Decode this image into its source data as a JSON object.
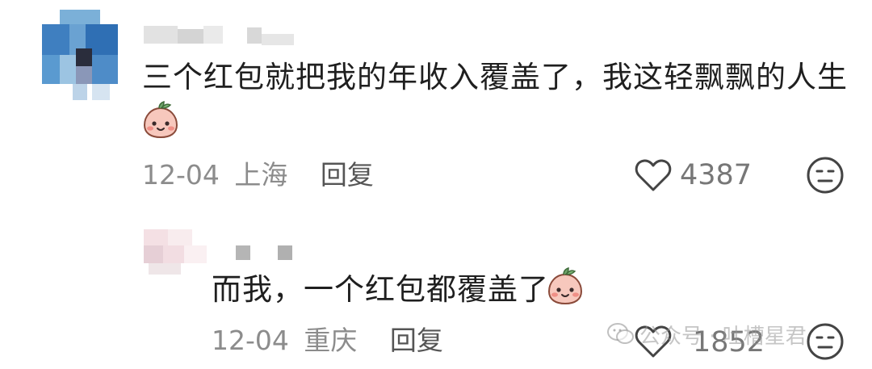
{
  "comments": [
    {
      "text": "三个红包就把我的年收入覆盖了，我这轻飘飘的人生",
      "date": "12-04",
      "location": "上海",
      "reply_label": "回复",
      "likes": "4387",
      "avatar_icon": "blurred-avatar",
      "emoji_icon": "peach-face-emoji"
    },
    {
      "text": "而我，一个红包都覆盖了",
      "date": "12-04",
      "location": "重庆",
      "reply_label": "回复",
      "likes": "1852",
      "avatar_icon": "blurred-avatar",
      "emoji_icon": "peach-face-emoji"
    }
  ],
  "watermark": {
    "icon": "wechat-icon",
    "text": "公众号 · 吐槽星君"
  },
  "colors": {
    "text": "#1f1f1f",
    "meta": "#8c8c8c",
    "icon": "#444444",
    "peach": "#f7c8bd"
  }
}
